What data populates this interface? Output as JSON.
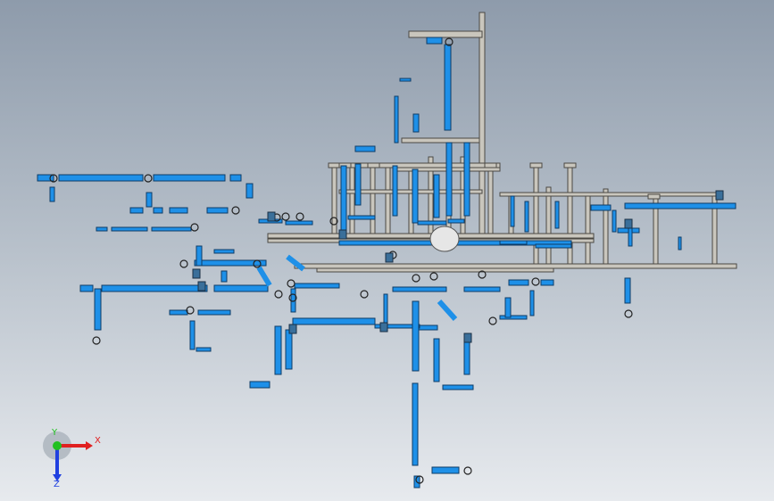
{
  "viewport": {
    "background_top": "#8e9bab",
    "background_bottom": "#e7eaee",
    "pipe_color": "#1e90e8",
    "frame_color": "#c9c6bd",
    "vessel_color": "#e6e6e6"
  },
  "model": {
    "description_icon": "piping-assembly-model"
  },
  "triad": {
    "x_label": "X",
    "y_label": "Y",
    "z_label": "Z",
    "x_color": "#e02020",
    "y_color": "#20c020",
    "z_color": "#2040e0"
  }
}
